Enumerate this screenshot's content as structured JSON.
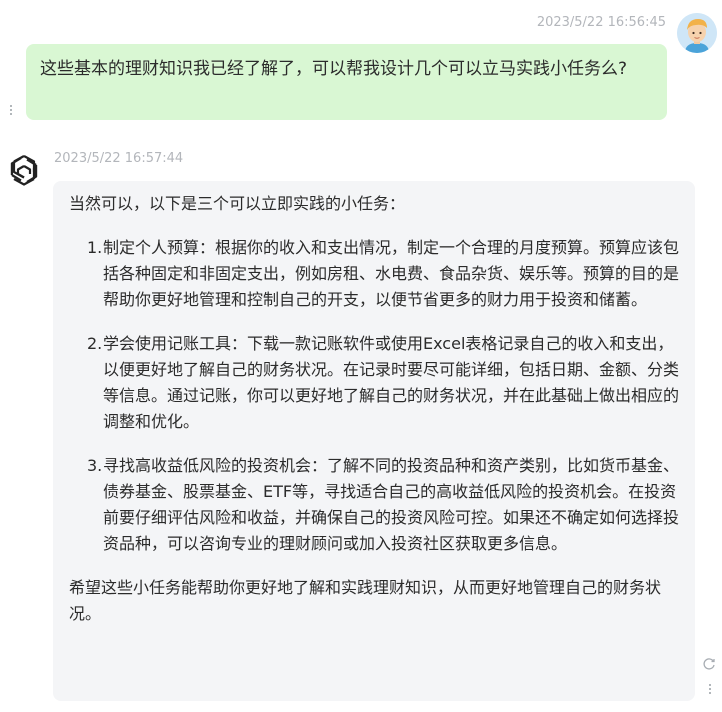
{
  "user_message": {
    "timestamp": "2023/5/22 16:56:45",
    "avatar_icon": "user-avatar-icon",
    "text": "这些基本的理财知识我已经了解了，可以帮我设计几个可以立马实践小任务么?",
    "bubble_color": "#d9f7d3"
  },
  "bot_message": {
    "timestamp": "2023/5/22 16:57:44",
    "avatar_icon": "openai-logo-icon",
    "intro": "当然可以，以下是三个可以立即实践的小任务：",
    "items": [
      {
        "num": "1.",
        "text": "制定个人预算：根据你的收入和支出情况，制定一个合理的月度预算。预算应该包括各种固定和非固定支出，例如房租、水电费、食品杂货、娱乐等。预算的目的是帮助你更好地管理和控制自己的开支，以便节省更多的财力用于投资和储蓄。"
      },
      {
        "num": "2.",
        "text": "学会使用记账工具：下载一款记账软件或使用Excel表格记录自己的收入和支出，以便更好地了解自己的财务状况。在记录时要尽可能详细，包括日期、金额、分类等信息。通过记账，你可以更好地了解自己的财务状况，并在此基础上做出相应的调整和优化。"
      },
      {
        "num": "3.",
        "text": "寻找高收益低风险的投资机会：了解不同的投资品种和资产类别，比如货币基金、债券基金、股票基金、ETF等，寻找适合自己的高收益低风险的投资机会。在投资前要仔细评估风险和收益，并确保自己的投资风险可控。如果还不确定如何选择投资品种，可以咨询专业的理财顾问或加入投资社区获取更多信息。"
      }
    ],
    "outro": "希望这些小任务能帮助你更好地了解和实践理财知识，从而更好地管理自己的财务状况。",
    "bubble_color": "#f4f5f7"
  },
  "icons": {
    "more": "kebab-menu-icon",
    "regenerate": "refresh-icon"
  }
}
